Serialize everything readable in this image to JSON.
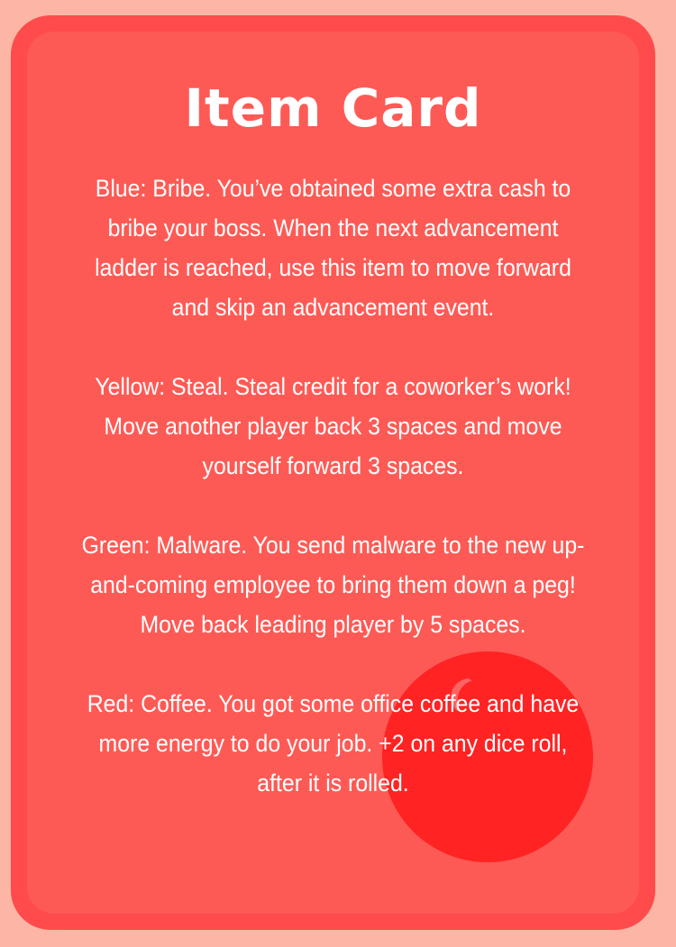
{
  "card": {
    "title": "Item Card",
    "items": [
      {
        "text": "Blue: Bribe. You’ve obtained some extra cash to bribe your boss. When the next advancement ladder is reached, use this item to move forward and skip an advancement event."
      },
      {
        "text": "Yellow: Steal. Steal credit for a coworker’s work! Move another player back 3 spaces and move yourself forward 3 spaces."
      },
      {
        "text": "Green: Malware. You send malware to the new up-and-coming employee to bring them down a peg! Move back leading player by 5 spaces."
      },
      {
        "text": "Red: Coffee. You got some office coffee and have more energy to do your job. +2 on any dice roll, after it is rolled."
      }
    ]
  },
  "colors": {
    "background": "#fdb6a6",
    "card_border": "#ff4b4b",
    "card_fill": "#fe5a55",
    "token": "#ff2323",
    "text": "#ffffff"
  },
  "icons": {
    "token": "red-circle-token-icon"
  }
}
